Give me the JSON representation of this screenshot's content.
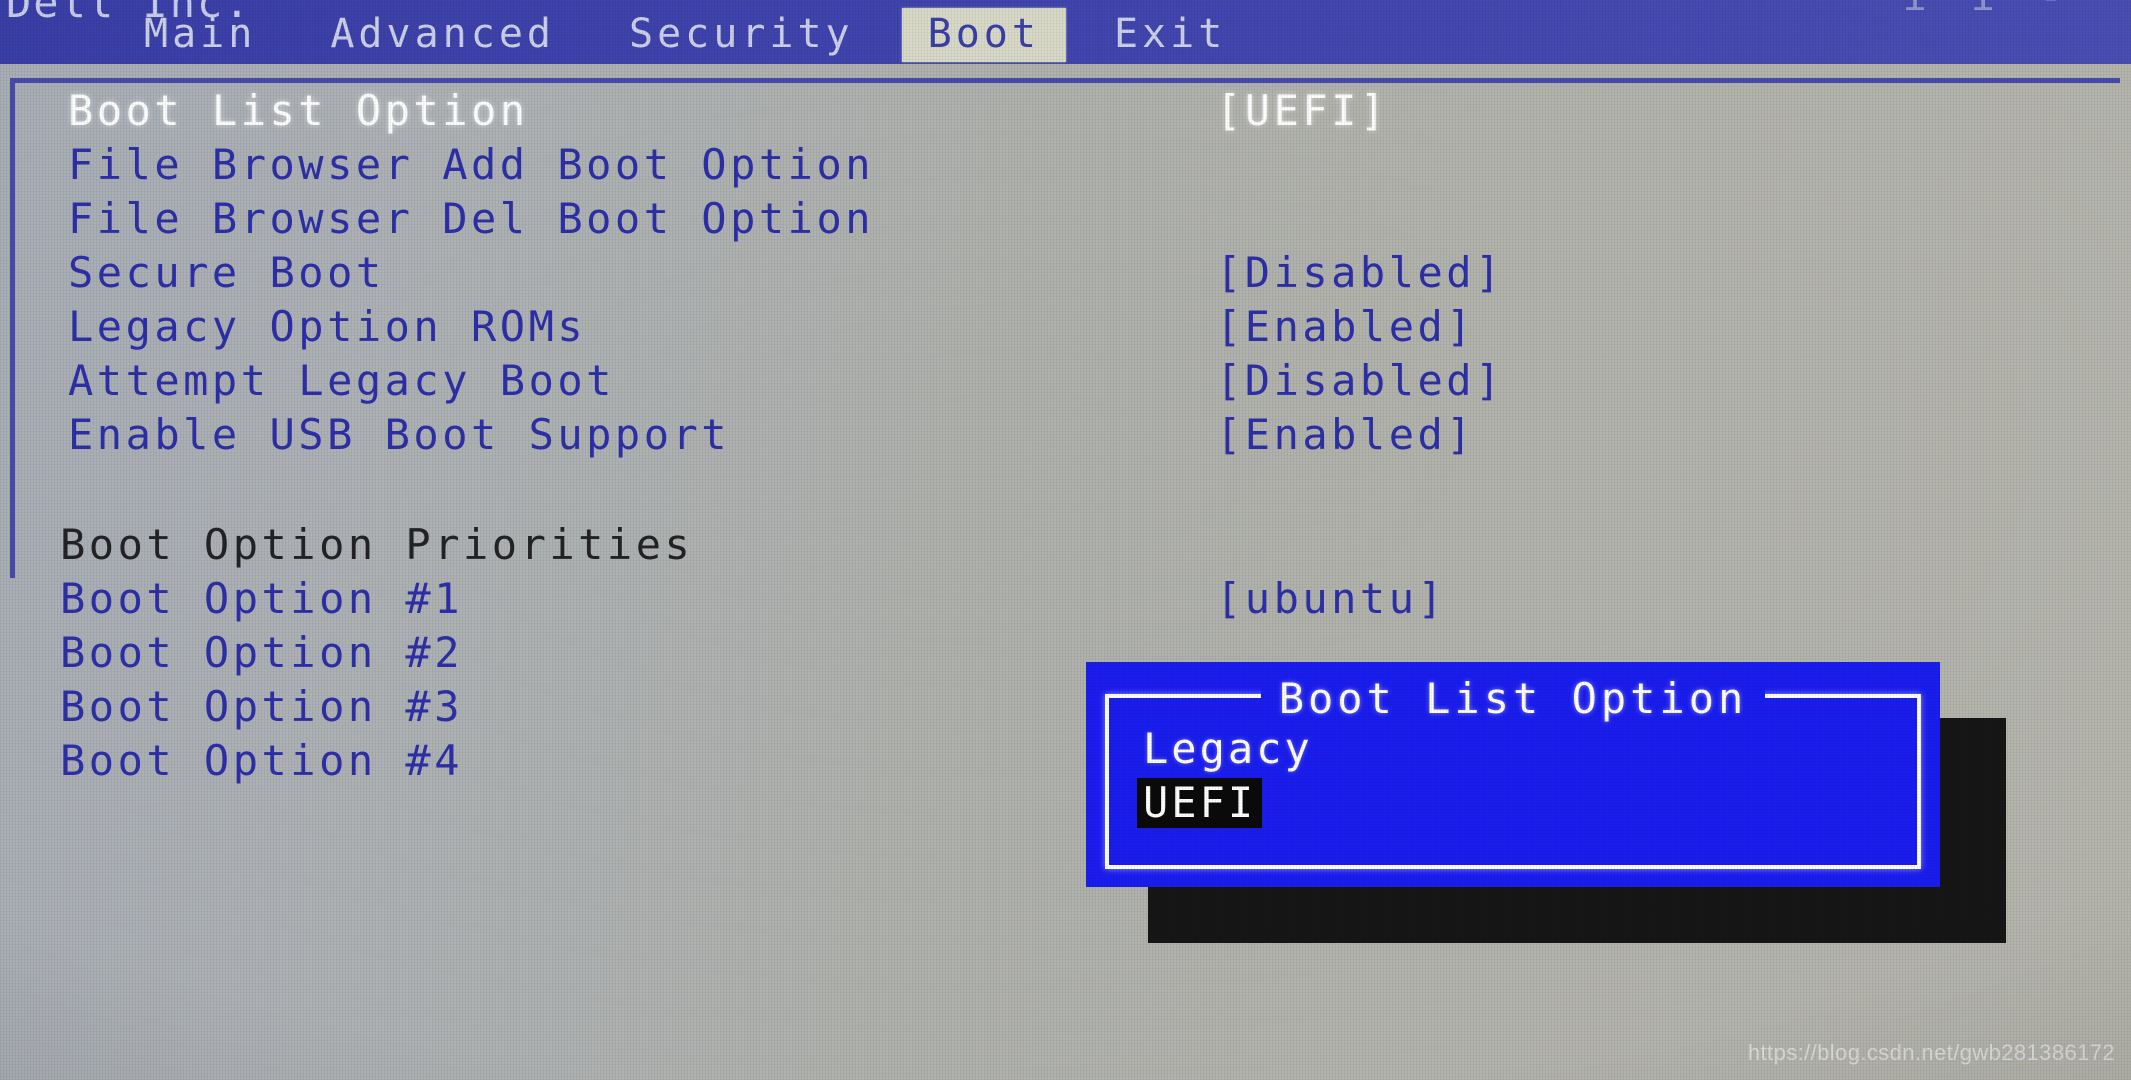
{
  "window": {
    "oem_name": "Dell Inc.",
    "oem_right": "i  i  -"
  },
  "colors": {
    "titlebar_blue": "#3f43ad",
    "active_tab_bg": "#d9dac8",
    "body_bg": "#b0b2ae",
    "text_blue": "#2d2fa8",
    "text_selected": "#ffffff",
    "heading_dark": "#232326",
    "dialog_blue": "#1a1df0",
    "dialog_border": "#ffffff",
    "dialog_shadow": "#161616",
    "highlight_bg": "#0a0a0a"
  },
  "menubar": {
    "tabs": [
      {
        "label": "Main",
        "active": false
      },
      {
        "label": "Advanced",
        "active": false
      },
      {
        "label": "Security",
        "active": false
      },
      {
        "label": "Boot",
        "active": true
      },
      {
        "label": "Exit",
        "active": false
      }
    ]
  },
  "settings": {
    "rows": [
      {
        "label": "Boot List Option",
        "value": "[UEFI]",
        "selected": true,
        "kind": "option"
      },
      {
        "label": "File Browser Add Boot Option",
        "value": "",
        "selected": false,
        "kind": "submenu"
      },
      {
        "label": "File Browser Del Boot Option",
        "value": "",
        "selected": false,
        "kind": "submenu"
      },
      {
        "label": "Secure Boot",
        "value": "[Disabled]",
        "selected": false,
        "kind": "option"
      },
      {
        "label": "Legacy Option ROMs",
        "value": "[Enabled]",
        "selected": false,
        "kind": "option"
      },
      {
        "label": "Attempt Legacy Boot",
        "value": "[Disabled]",
        "selected": false,
        "kind": "option"
      },
      {
        "label": "Enable USB Boot Support",
        "value": "[Enabled]",
        "selected": false,
        "kind": "option"
      }
    ],
    "priorities_heading": "Boot Option Priorities",
    "priorities": [
      {
        "label": "Boot Option #1",
        "value": "[ubuntu]"
      },
      {
        "label": "Boot Option #2",
        "value": ""
      },
      {
        "label": "Boot Option #3",
        "value": ""
      },
      {
        "label": "Boot Option #4",
        "value": ""
      }
    ]
  },
  "dialog": {
    "title": "Boot List Option",
    "options": [
      {
        "label": "Legacy",
        "highlighted": false
      },
      {
        "label": "UEFI",
        "highlighted": true
      }
    ]
  },
  "watermark": {
    "text": "https://blog.csdn.net/gwb281386172"
  }
}
